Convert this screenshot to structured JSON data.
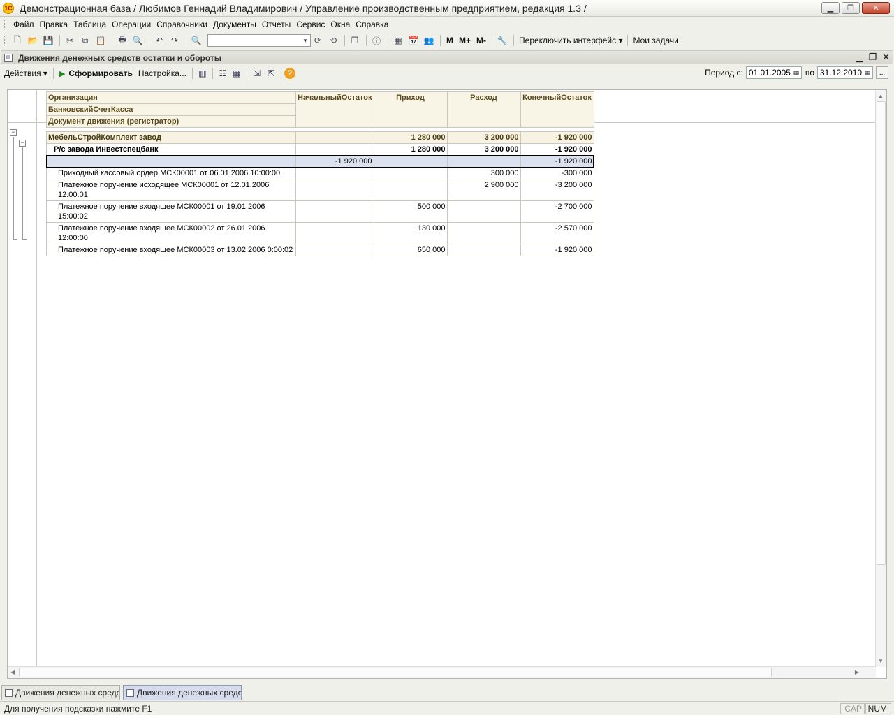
{
  "window": {
    "title": "Демонстрационная база / Любимов Геннадий Владимирович /  Управление производственным предприятием, редакция 1.3 /",
    "logo_text": "1С"
  },
  "menu": [
    "Файл",
    "Правка",
    "Таблица",
    "Операции",
    "Справочники",
    "Документы",
    "Отчеты",
    "Сервис",
    "Окна",
    "Справка"
  ],
  "toolbar": {
    "switch_interface": "Переключить интерфейс",
    "my_tasks": "Мои задачи",
    "m": "М",
    "m_plus": "М+",
    "m_minus": "М-"
  },
  "document": {
    "title": "Движения денежных средств остатки и обороты"
  },
  "report_toolbar": {
    "actions": "Действия",
    "generate": "Сформировать",
    "settings": "Настройка...",
    "period_from_label": "Период с:",
    "period_from": "01.01.2005",
    "period_to_label": "по",
    "period_to": "31.12.2010"
  },
  "report": {
    "headers": {
      "org": "Организация",
      "account": "БанковскийСчетКасса",
      "doc": "Документ движения (регистратор)",
      "start": "НачальныйОстаток",
      "income": "Приход",
      "expense": "Расход",
      "end": "КонечныйОстаток"
    },
    "org_row": {
      "name": "МебельСтройКомплект завод",
      "start": "",
      "income": "1 280 000",
      "expense": "3 200 000",
      "end": "-1 920 000"
    },
    "account_row": {
      "name": "Р/с завода Инвестспецбанк",
      "start": "",
      "income": "1 280 000",
      "expense": "3 200 000",
      "end": "-1 920 000"
    },
    "selected_row": {
      "name": "",
      "start": "-1 920 000",
      "income": "",
      "expense": "",
      "end": "-1 920 000"
    },
    "docs": [
      {
        "name": "Приходный кассовый ордер МСК00001 от 06.01.2006 10:00:00",
        "start": "",
        "income": "",
        "expense": "300 000",
        "end": "-300 000"
      },
      {
        "name": "Платежное поручение исходящее МСК00001 от 12.01.2006 12:00:01",
        "start": "",
        "income": "",
        "expense": "2 900 000",
        "end": "-3 200 000"
      },
      {
        "name": "Платежное поручение входящее МСК00001 от 19.01.2006 15:00:02",
        "start": "",
        "income": "500 000",
        "expense": "",
        "end": "-2 700 000"
      },
      {
        "name": "Платежное поручение входящее МСК00002 от 26.01.2006 12:00:00",
        "start": "",
        "income": "130 000",
        "expense": "",
        "end": "-2 570 000"
      },
      {
        "name": "Платежное поручение входящее МСК00003 от 13.02.2006 0:00:02",
        "start": "",
        "income": "650 000",
        "expense": "",
        "end": "-1 920 000"
      }
    ]
  },
  "taskbar": [
    "Движения денежных средс...",
    "Движения денежных средс..."
  ],
  "status": {
    "hint": "Для получения подсказки нажмите F1",
    "cap": "CAP",
    "num": "NUM"
  }
}
